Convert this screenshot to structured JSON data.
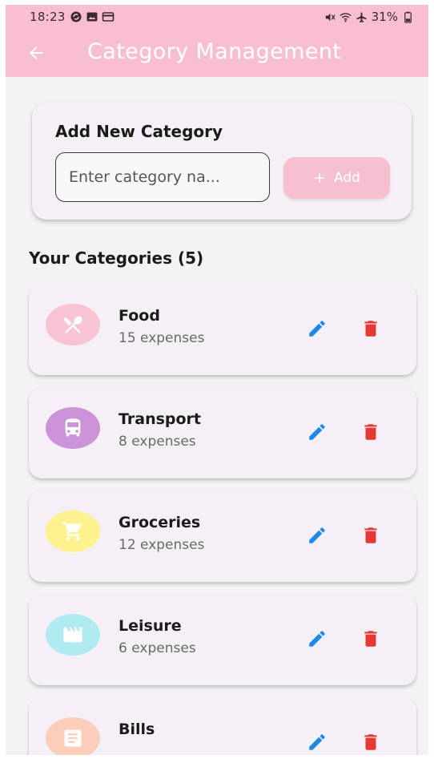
{
  "status_bar": {
    "time": "18:23",
    "battery": "31%",
    "left_icons": [
      "sync-icon",
      "photo-icon",
      "card-icon"
    ],
    "right_icons": [
      "mute-icon",
      "wifi-icon",
      "airplane-icon",
      "battery-icon"
    ]
  },
  "app_bar": {
    "title": "Category Management",
    "background": "#f8bfd0"
  },
  "add_card": {
    "title": "Add New Category",
    "input_placeholder": "Enter category na...",
    "input_value": "",
    "button_label": "Add",
    "button_color": "#f6c0d0"
  },
  "categories_section": {
    "heading": "Your Categories (5)"
  },
  "categories": [
    {
      "name": "Food",
      "count": "15 expenses",
      "icon": "restaurant-icon",
      "color": "#f8c3d2"
    },
    {
      "name": "Transport",
      "count": "8 expenses",
      "icon": "bus-icon",
      "color": "#cc93d9"
    },
    {
      "name": "Groceries",
      "count": "12 expenses",
      "icon": "cart-icon",
      "color": "#fdf28e"
    },
    {
      "name": "Leisure",
      "count": "6 expenses",
      "icon": "movie-icon",
      "color": "#b0ebf2"
    },
    {
      "name": "Bills",
      "count": "",
      "icon": "receipt-icon",
      "color": "#fccdb8"
    }
  ],
  "colors": {
    "edit": "#1e88e5",
    "delete": "#e53935",
    "background": "#f4f2f5"
  }
}
